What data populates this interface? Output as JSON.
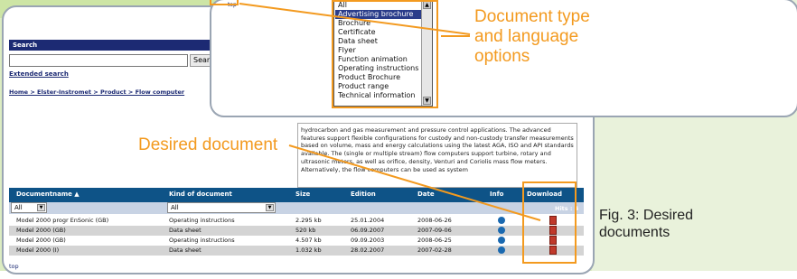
{
  "search": {
    "title": "Search",
    "button_label": "Search",
    "extended_link": "Extended search"
  },
  "breadcrumb": "Home  >  Elster-Instromet  >  Product  >  Flow computer",
  "description": "hydrocarbon and gas measurement and pressure control applications. The advanced features support flexible configurations for custody and non-custody transfer measurements based on volume, mass and energy calculations using the latest AGA, ISO and API standards available. The (single or multiple stream) flow computers support turbine, rotary and ultrasonic meters, as well as orifice, density, Venturi and Coriolis mass flow meters. Alternatively, the flow computers can be used as system",
  "table": {
    "headers": [
      "Documentname ▲",
      "Kind of document",
      "Size",
      "Edition",
      "Date",
      "Info",
      "Download"
    ],
    "filter_name": "All",
    "filter_kind": "All",
    "hits": "Hits : 4",
    "rows": [
      {
        "name": "Model 2000 progr EnSonic (GB)",
        "kind": "Operating instructions",
        "size": "2.295 kb",
        "edition": "25.01.2004",
        "date": "2008-06-26"
      },
      {
        "name": "Model 2000 (GB)",
        "kind": "Data sheet",
        "size": "520 kb",
        "edition": "06.09.2007",
        "date": "2007-09-06"
      },
      {
        "name": "Model 2000 (GB)",
        "kind": "Operating instructions",
        "size": "4.507 kb",
        "edition": "09.09.2003",
        "date": "2008-06-25"
      },
      {
        "name": "Model 2000 (I)",
        "kind": "Data sheet",
        "size": "1.032 kb",
        "edition": "28.02.2007",
        "date": "2007-02-28"
      }
    ],
    "top_link": "top"
  },
  "popup": {
    "top_link": "top",
    "listbox_items": [
      "All",
      "Advertising brochure",
      "Brochure",
      "Certificate",
      "Data sheet",
      "Flyer",
      "Function animation",
      "Operating instructions",
      "Product Brochure",
      "Product range",
      "Technical information"
    ],
    "selected_index": 1
  },
  "callouts": {
    "doc_type": "Document type and language options",
    "desired": "Desired document"
  },
  "caption": "Fig. 3: Desired documents",
  "colors": {
    "accent": "#f39a1f",
    "header_blue": "#0e5387",
    "navy": "#1c2a73"
  }
}
